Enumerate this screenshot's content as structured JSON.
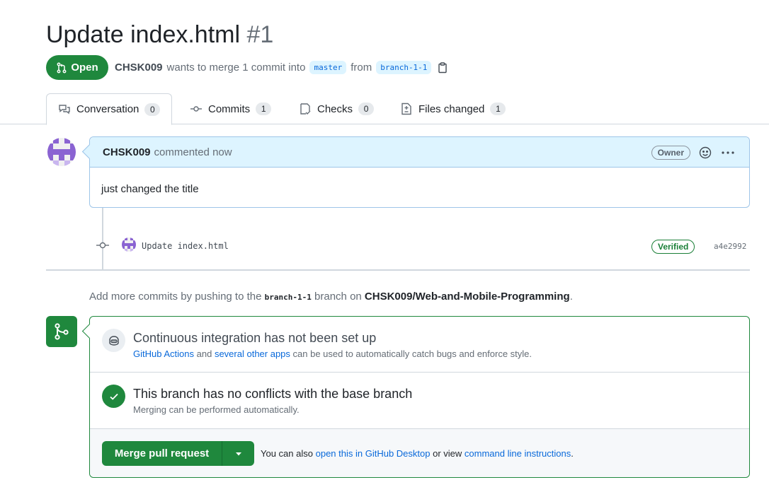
{
  "pull_request": {
    "title": "Update index.html",
    "number": "#1",
    "state_label": "Open",
    "author": "CHSK009",
    "merge_text": "wants to merge 1 commit into",
    "base_branch": "master",
    "from_text": "from",
    "head_branch": "branch-1-1"
  },
  "tabs": [
    {
      "label": "Conversation",
      "count": "0",
      "icon": "comment-discussion-icon"
    },
    {
      "label": "Commits",
      "count": "1",
      "icon": "git-commit-icon"
    },
    {
      "label": "Checks",
      "count": "0",
      "icon": "checklist-icon"
    },
    {
      "label": "Files changed",
      "count": "1",
      "icon": "file-diff-icon"
    }
  ],
  "comment": {
    "author": "CHSK009",
    "action": "commented now",
    "role_badge": "Owner",
    "body": "just changed the title"
  },
  "commit": {
    "message": "Update index.html",
    "verified_label": "Verified",
    "sha": "a4e2992"
  },
  "push_hint": {
    "prefix": "Add more commits by pushing to the",
    "branch": "branch-1-1",
    "middle": "branch on",
    "repo": "CHSK009/Web-and-Mobile-Programming",
    "suffix": "."
  },
  "merge_box": {
    "ci_heading": "Continuous integration has not been set up",
    "ci_link1": "GitHub Actions",
    "ci_and": "and",
    "ci_link2": "several other apps",
    "ci_rest": "can be used to automatically catch bugs and enforce style.",
    "conflicts_heading": "This branch has no conflicts with the base branch",
    "conflicts_sub": "Merging can be performed automatically.",
    "merge_button": "Merge pull request",
    "alt_prefix": "You can also",
    "alt_link1": "open this in GitHub Desktop",
    "alt_middle": "or view",
    "alt_link2": "command line instructions",
    "alt_suffix": "."
  },
  "colors": {
    "open_green": "#1f883d",
    "link_blue": "#0969da",
    "comment_header_bg": "#ddf4ff",
    "avatar_purple": "#8a63d2"
  }
}
